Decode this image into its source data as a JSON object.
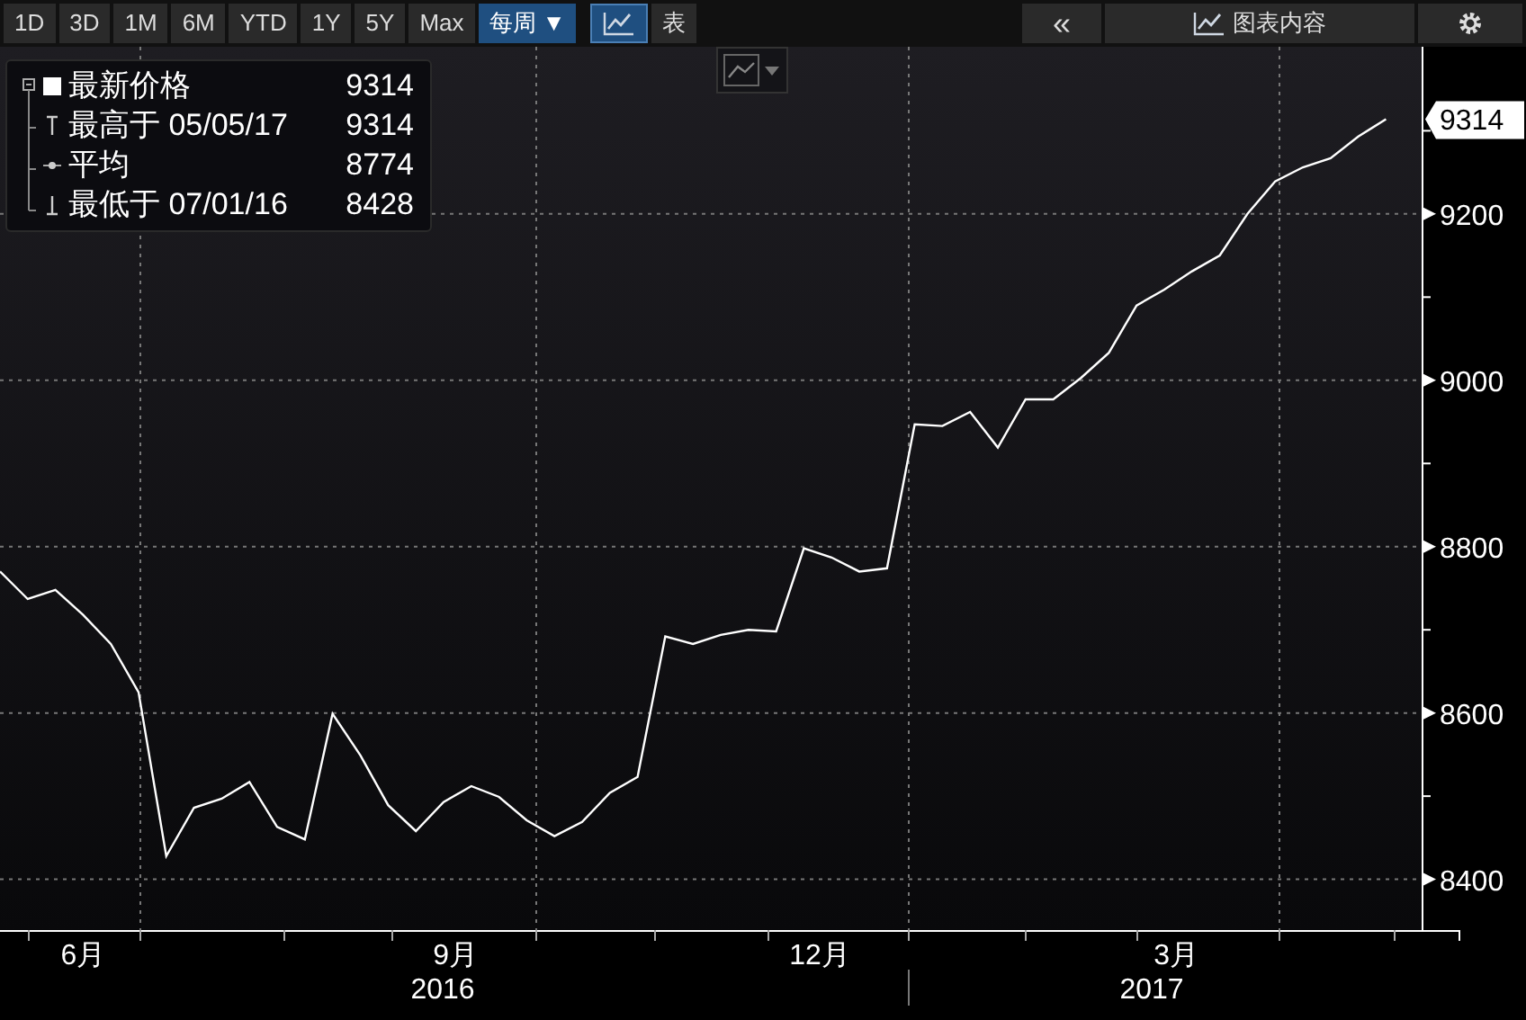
{
  "toolbar": {
    "ranges": [
      {
        "label": "1D",
        "selected": false
      },
      {
        "label": "3D",
        "selected": false
      },
      {
        "label": "1M",
        "selected": false
      },
      {
        "label": "6M",
        "selected": false
      },
      {
        "label": "YTD",
        "selected": false
      },
      {
        "label": "1Y",
        "selected": false
      },
      {
        "label": "5Y",
        "selected": false
      },
      {
        "label": "Max",
        "selected": false
      }
    ],
    "frequency": {
      "label": "每周 ▼",
      "selected": true
    },
    "views": [
      {
        "kind": "chart",
        "selected": true
      },
      {
        "kind": "table",
        "label": "表",
        "selected": false
      }
    ],
    "collapse": "«",
    "chart_contents": "图表内容"
  },
  "legend": {
    "rows": [
      {
        "kind": "last",
        "value": "9314"
      },
      {
        "kind": "high",
        "label": "最高于 05/05/17",
        "value": "9314"
      },
      {
        "kind": "avg",
        "label": "平均",
        "value": "8774"
      },
      {
        "kind": "low",
        "label": "最低于 07/01/16",
        "value": "8428"
      }
    ]
  },
  "last_price_label": "9314",
  "year_labels": [
    "2016",
    "2017"
  ],
  "chart_data": {
    "type": "line",
    "x": [
      "2016-05-20",
      "2016-05-27",
      "2016-06-03",
      "2016-06-10",
      "2016-06-17",
      "2016-06-24",
      "2016-07-01",
      "2016-07-08",
      "2016-07-15",
      "2016-07-22",
      "2016-07-29",
      "2016-08-05",
      "2016-08-12",
      "2016-08-19",
      "2016-08-26",
      "2016-09-02",
      "2016-09-09",
      "2016-09-16",
      "2016-09-23",
      "2016-09-30",
      "2016-10-07",
      "2016-10-14",
      "2016-10-21",
      "2016-10-28",
      "2016-11-04",
      "2016-11-11",
      "2016-11-18",
      "2016-11-25",
      "2016-12-02",
      "2016-12-09",
      "2016-12-16",
      "2016-12-23",
      "2016-12-30",
      "2017-01-06",
      "2017-01-13",
      "2017-01-20",
      "2017-01-27",
      "2017-02-03",
      "2017-02-10",
      "2017-02-17",
      "2017-02-24",
      "2017-03-03",
      "2017-03-10",
      "2017-03-17",
      "2017-03-24",
      "2017-03-31",
      "2017-04-07",
      "2017-04-14",
      "2017-04-21",
      "2017-04-28",
      "2017-05-05"
    ],
    "series": [
      {
        "name": "最新价格",
        "color": "#ffffff",
        "values": [
          8770,
          8737,
          8748,
          8718,
          8683,
          8625,
          8428,
          8486,
          8497,
          8517,
          8463,
          8448,
          8599,
          8549,
          8489,
          8458,
          8493,
          8512,
          8499,
          8471,
          8452,
          8469,
          8504,
          8523,
          8692,
          8683,
          8694,
          8700,
          8698,
          8798,
          8787,
          8770,
          8774,
          8947,
          8945,
          8962,
          8919,
          8977,
          8977,
          9003,
          9033,
          9090,
          9109,
          9131,
          9150,
          9200,
          9239,
          9256,
          9267,
          9293,
          9314
        ]
      }
    ],
    "xlim": [
      "2016-05-20",
      "2017-05-14"
    ],
    "ylim": [
      8339,
      9401
    ],
    "xticks": [
      {
        "value": "2016-06-10",
        "label": "6月"
      },
      {
        "value": "2016-09-12",
        "label": "9月"
      },
      {
        "value": "2016-12-13",
        "label": "12月"
      },
      {
        "value": "2017-03-13",
        "label": "3月"
      }
    ],
    "yticks": [
      8400,
      8600,
      8800,
      9000,
      9200
    ],
    "grid": true
  }
}
